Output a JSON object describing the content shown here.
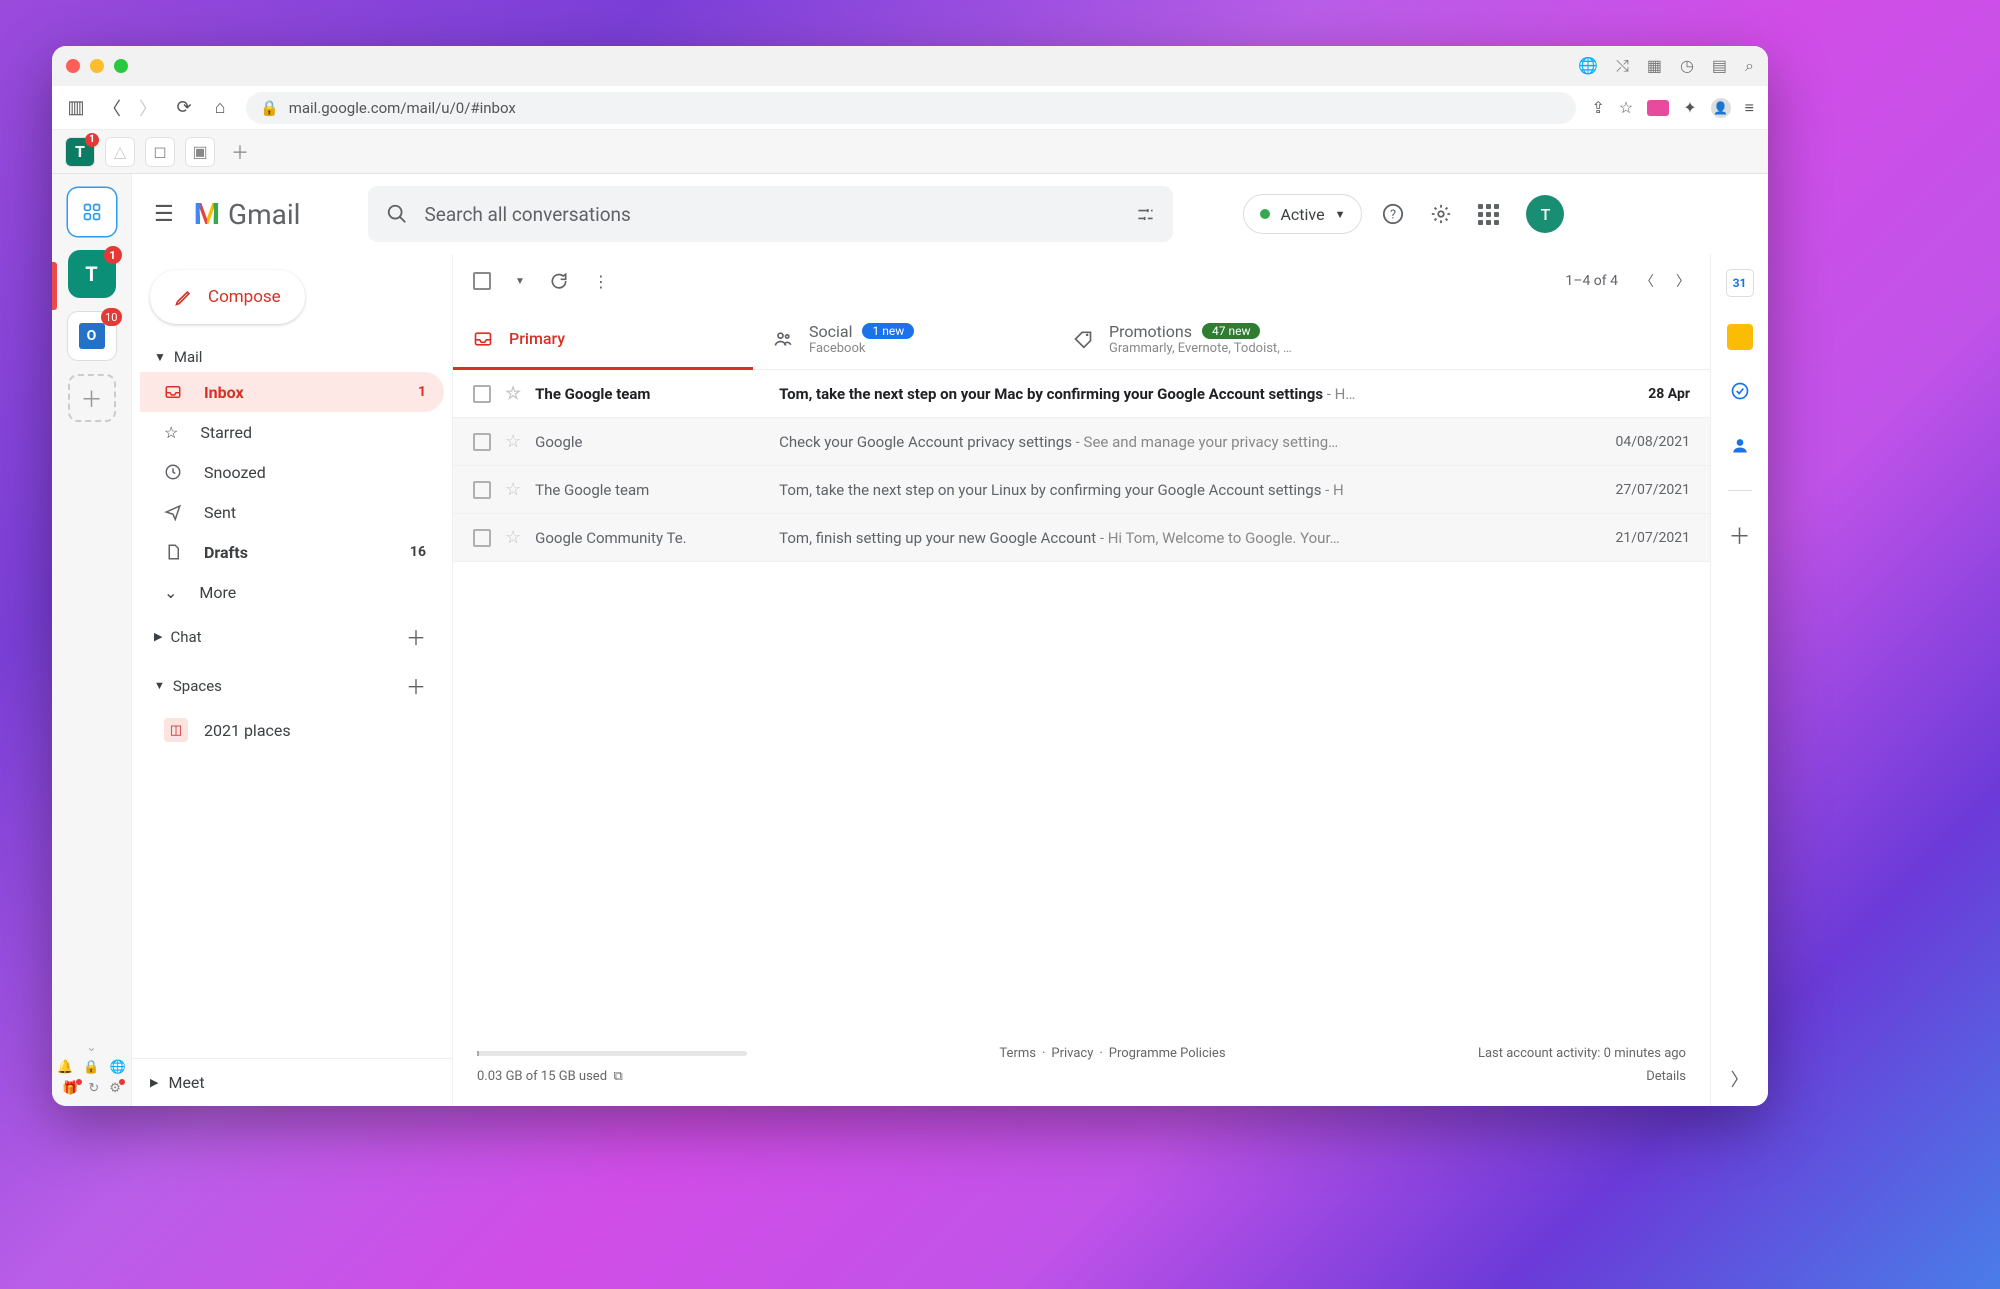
{
  "browser": {
    "url": "mail.google.com/mail/u/0/#inbox",
    "app_tab_badge": "1"
  },
  "left_rail": {
    "gmail_letter": "T",
    "gmail_badge": "1",
    "outlook_badge": "10"
  },
  "gmail": {
    "brand": "Gmail",
    "search_placeholder": "Search all conversations",
    "status_label": "Active",
    "avatar_letter": "T",
    "compose": "Compose",
    "sections": {
      "mail": "Mail",
      "chat": "Chat",
      "spaces": "Spaces",
      "meet": "Meet"
    },
    "nav": {
      "inbox": {
        "label": "Inbox",
        "count": "1"
      },
      "starred": "Starred",
      "snoozed": "Snoozed",
      "sent": "Sent",
      "drafts": {
        "label": "Drafts",
        "count": "16"
      },
      "more": "More"
    },
    "space_item": "2021 places",
    "toolbar": {
      "range": "1–4 of 4"
    },
    "tabs": {
      "primary": "Primary",
      "social": {
        "label": "Social",
        "badge": "1 new",
        "sub": "Facebook"
      },
      "promotions": {
        "label": "Promotions",
        "badge": "47 new",
        "sub": "Grammarly, Evernote, Todoist, …"
      }
    },
    "messages": [
      {
        "from": "The Google team",
        "subject": "Tom, take the next step on your Mac by confirming your Google Account settings",
        "snippet": " - H…",
        "date": "28 Apr",
        "unread": true
      },
      {
        "from": "Google",
        "subject": "Check your Google Account privacy settings",
        "snippet": " - See and manage your privacy setting…",
        "date": "04/08/2021",
        "unread": false
      },
      {
        "from": "The Google team",
        "subject": "Tom, take the next step on your Linux by confirming your Google Account settings",
        "snippet": " - H",
        "date": "27/07/2021",
        "unread": false
      },
      {
        "from": "Google Community Te.",
        "subject": "Tom, finish setting up your new Google Account",
        "snippet": " - Hi Tom, Welcome to Google. Your…",
        "date": "21/07/2021",
        "unread": false
      }
    ],
    "footer": {
      "storage": "0.03 GB of 15 GB used",
      "terms": "Terms",
      "privacy": "Privacy",
      "policies": "Programme Policies",
      "activity": "Last account activity: 0 minutes ago",
      "details": "Details"
    },
    "side_panel": {
      "calendar_day": "31"
    }
  }
}
